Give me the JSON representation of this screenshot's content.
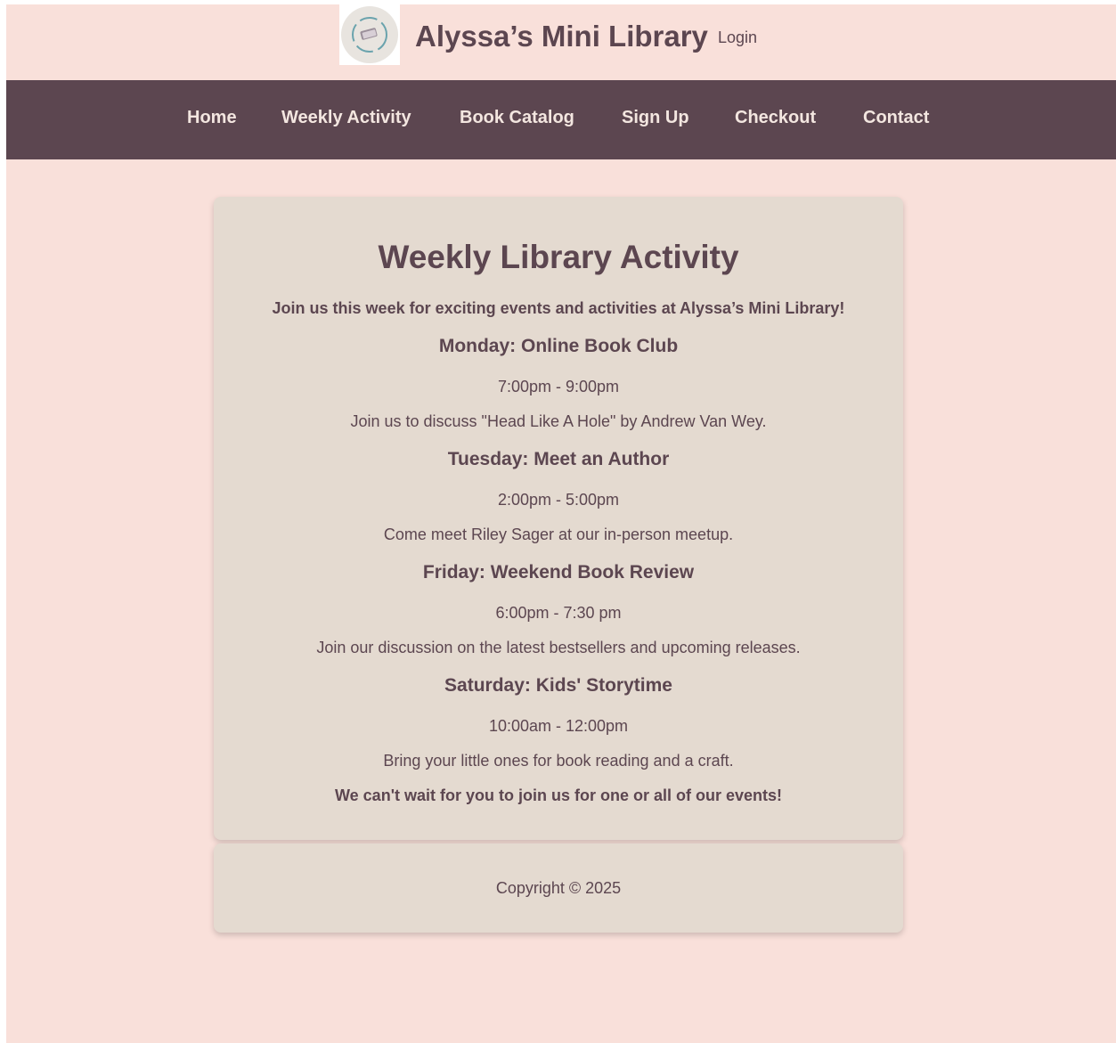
{
  "header": {
    "logo_icon": "book-logo-icon",
    "title": "Alyssa’s Mini Library",
    "login_label": "Login"
  },
  "nav": {
    "items": [
      {
        "label": "Home"
      },
      {
        "label": "Weekly Activity"
      },
      {
        "label": "Book Catalog"
      },
      {
        "label": "Sign Up"
      },
      {
        "label": "Checkout"
      },
      {
        "label": "Contact"
      }
    ]
  },
  "main": {
    "heading": "Weekly Library Activity",
    "intro": "Join us this week for exciting events and activities at Alyssa’s Mini Library!",
    "events": [
      {
        "title": "Monday: Online Book Club",
        "time": "7:00pm - 9:00pm",
        "description": "Join us to discuss \"Head Like A Hole\" by Andrew Van Wey."
      },
      {
        "title": "Tuesday: Meet an Author",
        "time": "2:00pm - 5:00pm",
        "description": "Come meet Riley Sager at our in-person meetup."
      },
      {
        "title": "Friday: Weekend Book Review",
        "time": "6:00pm - 7:30 pm",
        "description": "Join our discussion on the latest bestsellers and upcoming releases."
      },
      {
        "title": "Saturday: Kids' Storytime",
        "time": "10:00am - 12:00pm",
        "description": "Bring your little ones for book reading and a craft."
      }
    ],
    "closing": "We can't wait for you to join us for one or all of our events!"
  },
  "footer": {
    "copyright": "Copyright © 2025"
  },
  "colors": {
    "page_background": "#f9e0da",
    "nav_background": "#5c4650",
    "card_background": "#e4dad0",
    "text": "#5c4650"
  }
}
